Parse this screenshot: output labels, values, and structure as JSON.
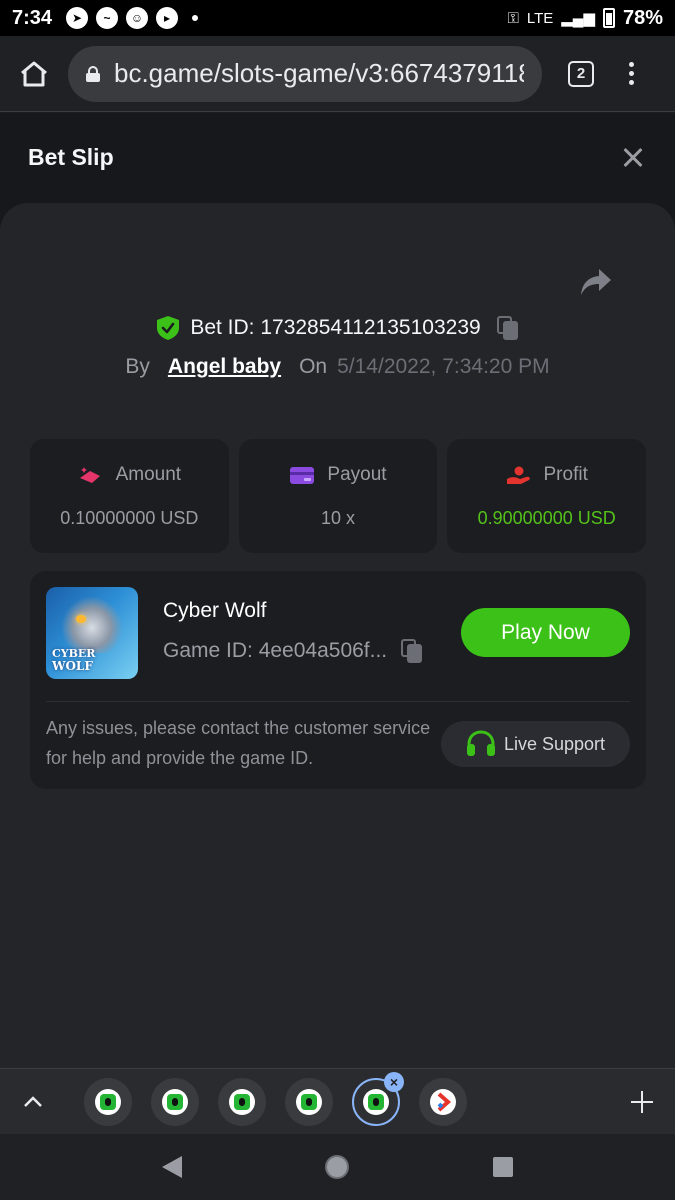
{
  "status_bar": {
    "time": "7:34",
    "network": "LTE",
    "battery": "78%"
  },
  "browser": {
    "url": "bc.game/slots-game/v3:66743791181",
    "tab_count": "2"
  },
  "modal": {
    "title": "Bet Slip",
    "bet_id": "Bet ID: 1732854112135103239",
    "by_label": "By",
    "user": "Angel baby",
    "on_label": "On",
    "date": "5/14/2022, 7:34:20 PM"
  },
  "stats": [
    {
      "label": "Amount",
      "value": "0.10000000 USD",
      "icon": "amount-icon"
    },
    {
      "label": "Payout",
      "value": "10 x",
      "icon": "payout-icon"
    },
    {
      "label": "Profit",
      "value": "0.90000000 USD",
      "icon": "profit-icon"
    }
  ],
  "game": {
    "name": "Cyber Wolf",
    "game_id": "Game ID: 4ee04a506f...",
    "thumbnail_line1": "CYBER",
    "thumbnail_line2": "WOLF",
    "play_label": "Play Now",
    "help_text": "Any issues, please contact the customer service for help and provide the game ID.",
    "support_label": "Live Support"
  },
  "colors": {
    "accent_green": "#3bc117",
    "profit_green": "#54c21a",
    "background": "#17181b",
    "card": "#1b1d20"
  }
}
